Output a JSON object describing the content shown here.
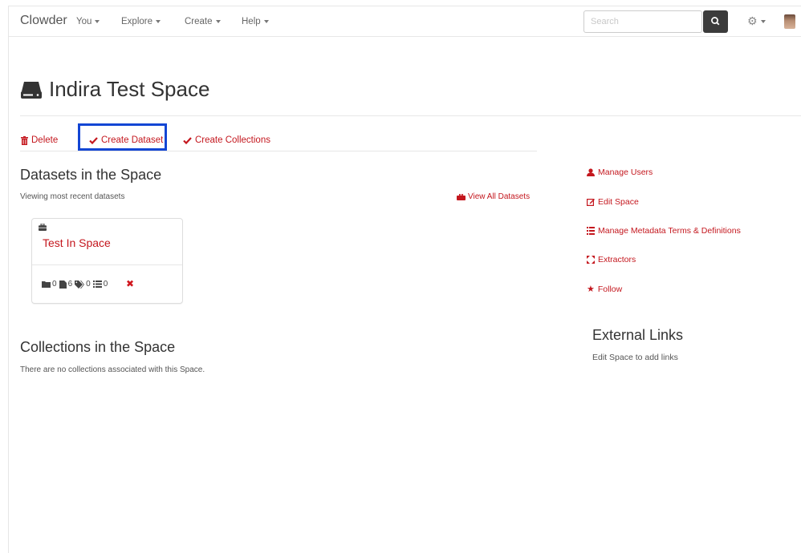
{
  "navbar": {
    "brand": "Clowder",
    "menus": [
      {
        "label": "You"
      },
      {
        "label": "Explore"
      },
      {
        "label": "Create"
      },
      {
        "label": "Help"
      }
    ],
    "search": {
      "placeholder": "Search",
      "value": ""
    }
  },
  "header": {
    "title": "Indira Test Space"
  },
  "actions": {
    "delete": "Delete",
    "create_dataset": "Create Dataset",
    "create_collections": "Create Collections"
  },
  "datasets_section": {
    "heading": "Datasets in the Space",
    "subtext": "Viewing most recent datasets",
    "view_all": "View All Datasets",
    "cards": [
      {
        "title": "Test In Space",
        "folders": "0",
        "files": "6",
        "tags": "0",
        "comments": "0"
      }
    ]
  },
  "collections_section": {
    "heading": "Collections in the Space",
    "empty_text": "There are no collections associated with this Space."
  },
  "sidebar": {
    "links": [
      {
        "label": "Manage Users",
        "icon": "user-icon"
      },
      {
        "label": "Edit Space",
        "icon": "edit-icon"
      },
      {
        "label": "Manage Metadata Terms & Definitions",
        "icon": "list-icon"
      },
      {
        "label": "Extractors",
        "icon": "fullscreen-icon"
      },
      {
        "label": "Follow",
        "icon": "star-icon"
      }
    ],
    "external_links": {
      "heading": "External Links",
      "text": "Edit Space to add links"
    }
  },
  "colors": {
    "accent": "#c4171e",
    "highlight": "#1346d4",
    "navbar_button": "#3b3b3b"
  }
}
